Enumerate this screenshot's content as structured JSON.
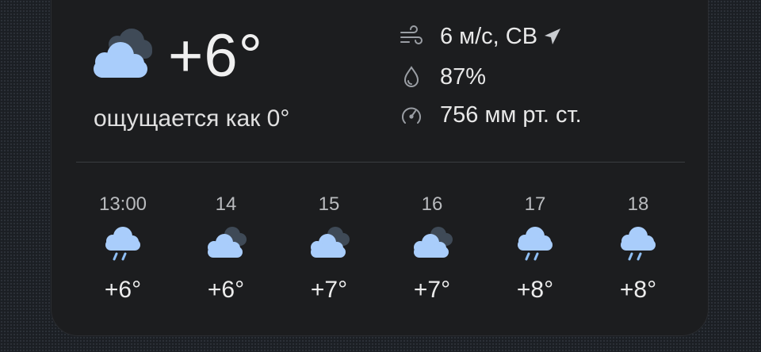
{
  "current": {
    "condition_icon": "cloudy-icon",
    "temperature": "+6°",
    "feels_like": "ощущается как 0°",
    "wind": "6 м/с, СВ",
    "humidity": "87%",
    "pressure": "756 мм рт. ст."
  },
  "hourly": [
    {
      "time": "13:00",
      "icon": "rain-icon",
      "temp": "+6°"
    },
    {
      "time": "14",
      "icon": "cloudy-icon",
      "temp": "+6°"
    },
    {
      "time": "15",
      "icon": "cloudy-icon",
      "temp": "+7°"
    },
    {
      "time": "16",
      "icon": "cloudy-icon",
      "temp": "+7°"
    },
    {
      "time": "17",
      "icon": "rain-icon",
      "temp": "+8°"
    },
    {
      "time": "18",
      "icon": "rain-icon",
      "temp": "+8°"
    }
  ],
  "colors": {
    "cloud_front": "#a9cdfb",
    "cloud_back": "#3f4a57",
    "rain": "#8fbff5",
    "background": "#1b1f24",
    "card": "#1c1d1f"
  }
}
